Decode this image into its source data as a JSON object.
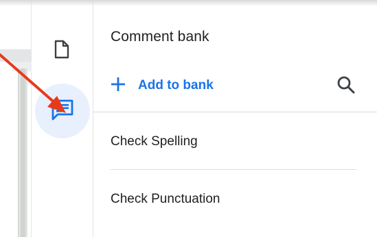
{
  "panel": {
    "title": "Comment bank",
    "add_label": "Add to bank",
    "items": [
      {
        "label": "Check Spelling"
      },
      {
        "label": "Check Punctuation"
      }
    ]
  },
  "rail": {
    "items": [
      {
        "icon": "document-icon"
      },
      {
        "icon": "comment-icon",
        "active": true
      }
    ]
  },
  "colors": {
    "accent": "#1a73e8",
    "active_bg": "#e8f0fe",
    "annotation_arrow": "#e8391a",
    "text": "#202124"
  }
}
